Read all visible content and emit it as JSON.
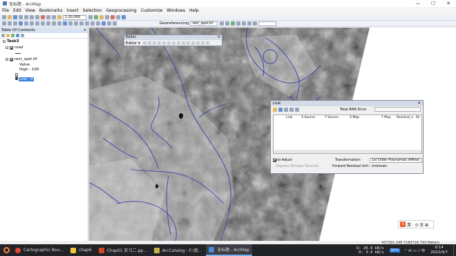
{
  "window": {
    "title": "无标题 - ArcMap",
    "controls": [
      "—",
      "☐",
      "✕"
    ]
  },
  "menu": [
    "File",
    "Edit",
    "View",
    "Bookmarks",
    "Insert",
    "Selection",
    "Geoprocessing",
    "Customize",
    "Windows",
    "Help"
  ],
  "toolbar": {
    "scale": "1:20,000",
    "georeferencing_label": "Georeferencing",
    "layer_combo": "rect_spot.tif"
  },
  "toc": {
    "title": "Table Of Contents",
    "close": "✕",
    "layers_root": "Task3",
    "layers": [
      {
        "name": "road"
      },
      {
        "name": "rect_spot.tif",
        "value_label": "Value",
        "high": "High : 100",
        "low": "Low : 0"
      }
    ]
  },
  "editor": {
    "title": "Editor",
    "menu_label": "Editor ▾"
  },
  "link": {
    "title": "Link",
    "rms_label": "Total RMS Error:",
    "columns": [
      "Link",
      "X Source",
      "Y Source",
      "X Map",
      "Y Map",
      "Residual_x",
      "Re"
    ],
    "auto_adjust": "Auto Adjust",
    "transformation_label": "Transformation:",
    "transformation_value": "1st Order Polynomial (Affine)",
    "degrees_label": "Degrees Minutes Seconds",
    "forward_residual": "Forward Residual Unit : Unknown"
  },
  "status": {
    "coords": "437391.249  7180716.793 Meters"
  },
  "ime": {
    "logo": "S",
    "text": "英 · ⊙ ☰ ⊞"
  },
  "taskbar": {
    "items": [
      {
        "label": "",
        "icon_color": "#f4f4f4"
      },
      {
        "label": "Cartographic Bou...",
        "icon_color": "#3e8de8"
      },
      {
        "label": "chap6",
        "icon_color": "#f3c53a"
      },
      {
        "label": "Chap01 实习二.pp...",
        "icon_color": "#d24726"
      },
      {
        "label": "ArcCatalog - F:\\我...",
        "icon_color": "#c8b24a"
      },
      {
        "label": "无标题 - ArcMap",
        "icon_color": "#4b8cd9",
        "active": true
      }
    ],
    "net_up": "U:   26.9 kB/s",
    "net_down": "D:    3.4 kB/s",
    "badge": "91%",
    "tray_icons": "⌃ ✉ ▭ ♪ 中",
    "time": "0:14",
    "date": "2022/4/7"
  },
  "colors": {
    "accent": "#3a7ee0",
    "road": "#3a3fb0",
    "taskbar": "#222326"
  }
}
